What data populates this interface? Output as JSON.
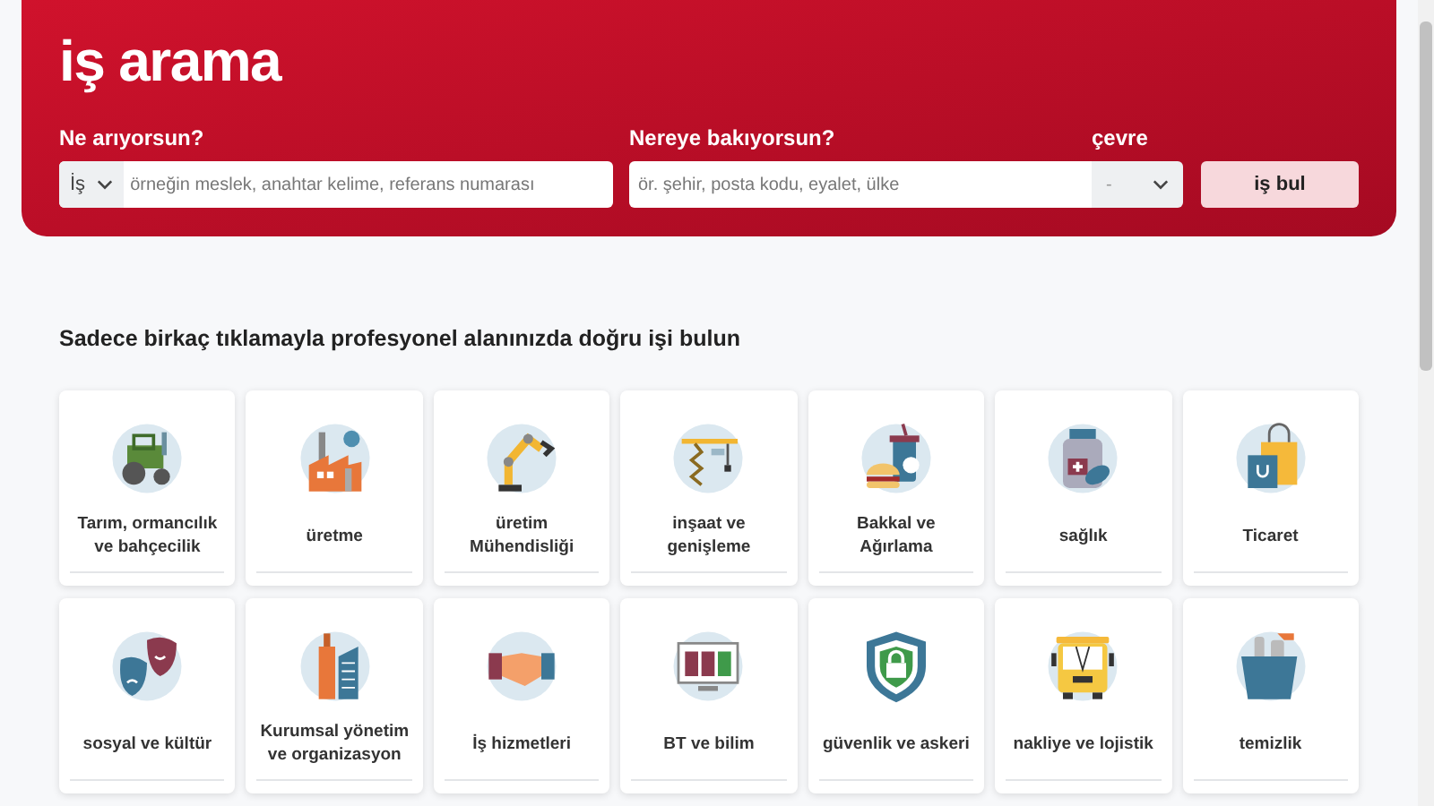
{
  "header": {
    "title": "iş arama",
    "what": {
      "label": "Ne arıyorsun?",
      "type_value": "İş",
      "placeholder": "örneğin meslek, anahtar kelime, referans numarası"
    },
    "where": {
      "label": "Nereye bakıyorsun?",
      "placeholder": "ör. şehir, posta kodu, eyalet, ülke"
    },
    "radius": {
      "label": "çevre",
      "value": "-"
    },
    "button": "iş bul"
  },
  "section_title": "Sadece birkaç tıklamayla profesyonel alanınızda doğru işi bulun",
  "categories": [
    {
      "label": "Tarım, ormancılık ve bahçecilik"
    },
    {
      "label": "üretme"
    },
    {
      "label": "üretim Mühendisliği"
    },
    {
      "label": "inşaat ve genişleme"
    },
    {
      "label": "Bakkal ve Ağırlama"
    },
    {
      "label": "sağlık"
    },
    {
      "label": "Ticaret"
    },
    {
      "label": "sosyal ve kültür"
    },
    {
      "label": "Kurumsal yönetim ve organizasyon"
    },
    {
      "label": "İş hizmetleri"
    },
    {
      "label": "BT ve bilim"
    },
    {
      "label": "güvenlik ve askeri"
    },
    {
      "label": "nakliye ve lojistik"
    },
    {
      "label": "temizlik"
    }
  ]
}
